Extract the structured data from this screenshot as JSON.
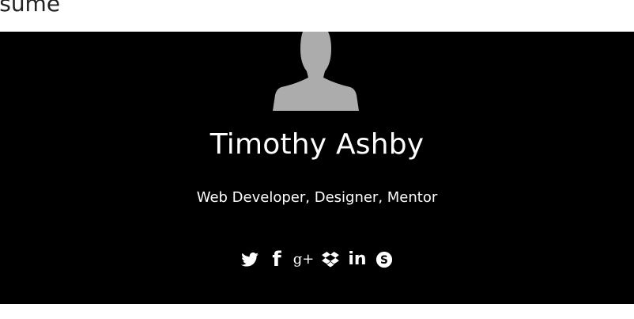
{
  "page": {
    "section_title": "esume"
  },
  "profile": {
    "name": "Timothy Ashby",
    "tagline": "Web Developer, Designer, Mentor"
  },
  "social": {
    "items": [
      {
        "icon": "twitter-icon"
      },
      {
        "icon": "facebook-icon",
        "glyph": "f"
      },
      {
        "icon": "google-plus-icon",
        "glyph": "g+"
      },
      {
        "icon": "dropbox-icon"
      },
      {
        "icon": "linkedin-icon",
        "glyph": "in"
      },
      {
        "icon": "skype-icon",
        "glyph": "S"
      }
    ]
  },
  "colors": {
    "hero_background": "#000000",
    "text": "#ffffff",
    "avatar_placeholder": "#acacac"
  }
}
